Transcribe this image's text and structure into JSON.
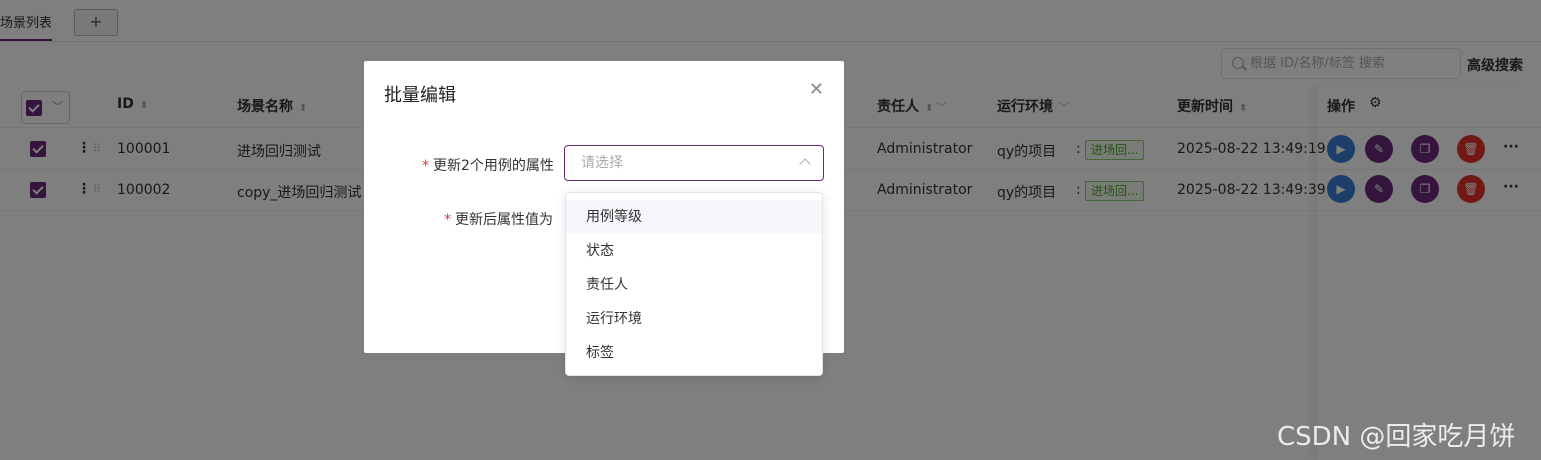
{
  "tabs": {
    "active_label": "场景列表",
    "add_label": "+"
  },
  "search": {
    "placeholder": "根据 ID/名称/标签 搜索",
    "advanced_label": "高级搜索"
  },
  "table": {
    "headers": {
      "id": "ID",
      "name": "场景名称",
      "owner": "责任人",
      "env": "运行环境",
      "updated": "更新时间",
      "ops": "操作"
    },
    "rows": [
      {
        "id": "100001",
        "name": "进场回归测试",
        "owner": "Administrator",
        "env": "qy的项目",
        "tag": "进场回...",
        "updated": "2025-08-22 13:49:19"
      },
      {
        "id": "100002",
        "name": "copy_进场回归测试",
        "owner": "Administrator",
        "env": "qy的项目",
        "tag": "进场回...",
        "updated": "2025-08-22 13:49:39"
      }
    ]
  },
  "modal": {
    "title": "批量编辑",
    "field1_label": "更新2个用例的属性",
    "field2_label": "更新后属性值为",
    "select_placeholder": "请选择",
    "options": [
      "用例等级",
      "状态",
      "责任人",
      "运行环境",
      "标签"
    ]
  },
  "colors": {
    "primary": "#6b2a7a",
    "run": "#3a7bd5",
    "delete": "#e5322d",
    "tag": "#52a42a"
  },
  "watermark": "CSDN @回家吃月饼"
}
